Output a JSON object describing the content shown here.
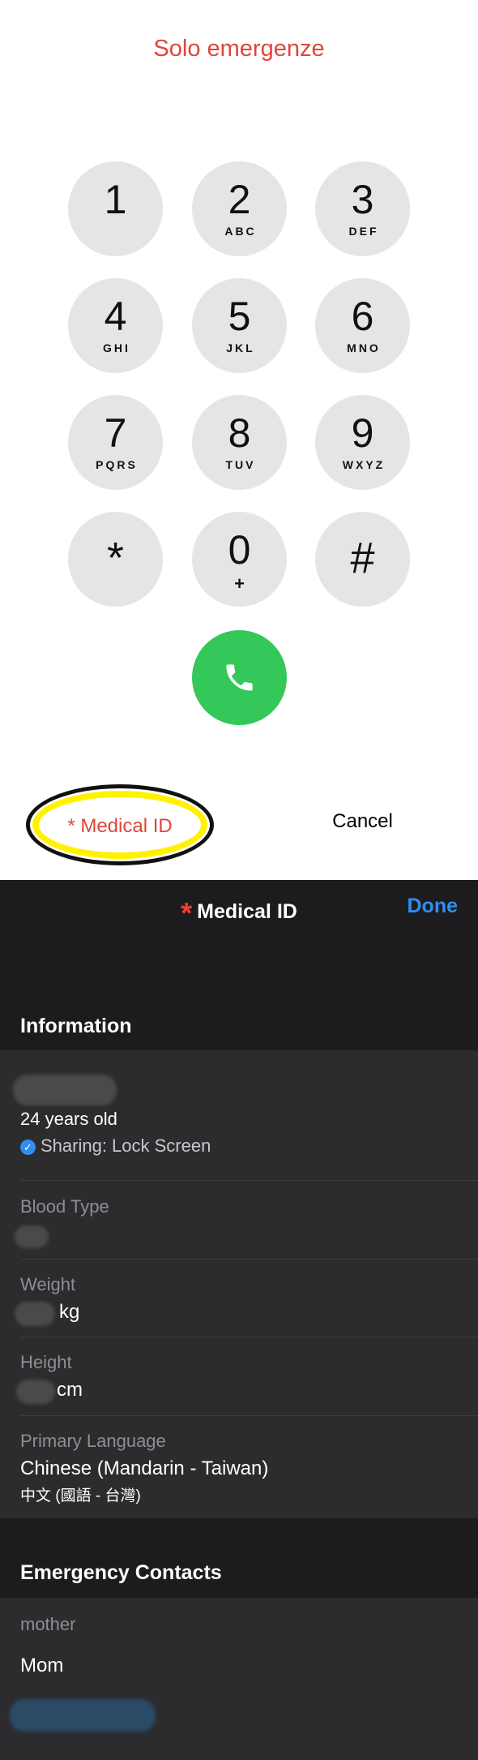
{
  "dialer": {
    "title": "Solo emergenze",
    "keys": [
      {
        "digit": "1",
        "letters": ""
      },
      {
        "digit": "2",
        "letters": "ABC"
      },
      {
        "digit": "3",
        "letters": "DEF"
      },
      {
        "digit": "4",
        "letters": "GHI"
      },
      {
        "digit": "5",
        "letters": "JKL"
      },
      {
        "digit": "6",
        "letters": "MNO"
      },
      {
        "digit": "7",
        "letters": "PQRS"
      },
      {
        "digit": "8",
        "letters": "TUV"
      },
      {
        "digit": "9",
        "letters": "WXYZ"
      },
      {
        "digit": "*",
        "letters": ""
      },
      {
        "digit": "0",
        "letters": "+"
      },
      {
        "digit": "#",
        "letters": ""
      }
    ],
    "medical_id_label": "* Medical ID",
    "cancel_label": "Cancel",
    "colors": {
      "accent": "#e0453a",
      "call": "#34c759",
      "key": "#e5e5e5",
      "highlight": "#fff200"
    }
  },
  "medical_id": {
    "title": "Medical ID",
    "title_icon": "*",
    "done_label": "Done",
    "information_header": "Information",
    "age": "24 years old",
    "sharing": "Sharing: Lock Screen",
    "blood_type_label": "Blood Type",
    "weight_label": "Weight",
    "weight_unit": "kg",
    "height_label": "Height",
    "height_unit": "cm",
    "language_label": "Primary Language",
    "language_value": "Chinese (Mandarin - Taiwan)",
    "language_native": "中文 (國語 - 台灣)",
    "contacts_header": "Emergency Contacts",
    "contact_relation": "mother",
    "contact_name": "Mom",
    "colors": {
      "background": "#1c1c1e",
      "card": "#2c2c2e",
      "link": "#2f8ff0",
      "asterisk": "#ff3b30"
    }
  }
}
